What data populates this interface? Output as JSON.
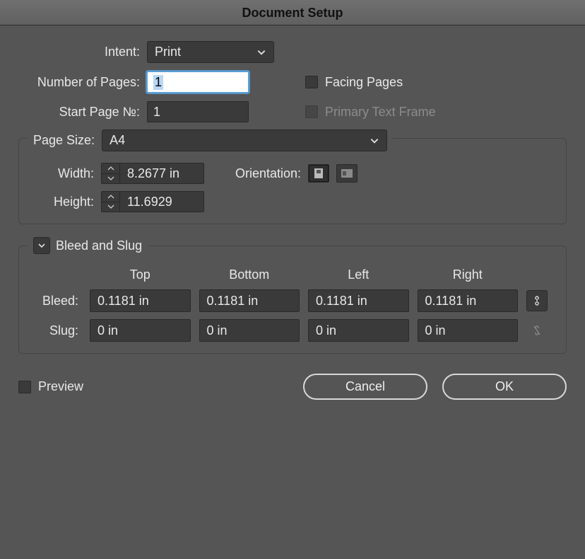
{
  "title": "Document Setup",
  "labels": {
    "intent": "Intent:",
    "numPages": "Number of Pages:",
    "startPage": "Start Page №:",
    "facing": "Facing Pages",
    "primary": "Primary Text Frame",
    "pageSize": "Page Size:",
    "width": "Width:",
    "height": "Height:",
    "orientation": "Orientation:",
    "bleedSlug": "Bleed and Slug",
    "top": "Top",
    "bottom": "Bottom",
    "left": "Left",
    "right": "Right",
    "bleed": "Bleed:",
    "slug": "Slug:",
    "preview": "Preview",
    "cancel": "Cancel",
    "ok": "OK"
  },
  "values": {
    "intent": "Print",
    "numPages": "1",
    "startPage": "1",
    "pageSize": "A4",
    "width": "8.2677 in",
    "height": "11.6929",
    "bleed": {
      "top": "0.1181 in",
      "bottom": "0.1181 in",
      "left": "0.1181 in",
      "right": "0.1181 in"
    },
    "slug": {
      "top": "0 in",
      "bottom": "0 in",
      "left": "0 in",
      "right": "0 in"
    }
  },
  "state": {
    "facingPages": false,
    "primaryTextFrame": false,
    "orientation": "portrait",
    "bleedLinked": true,
    "slugLinked": false,
    "preview": false
  }
}
